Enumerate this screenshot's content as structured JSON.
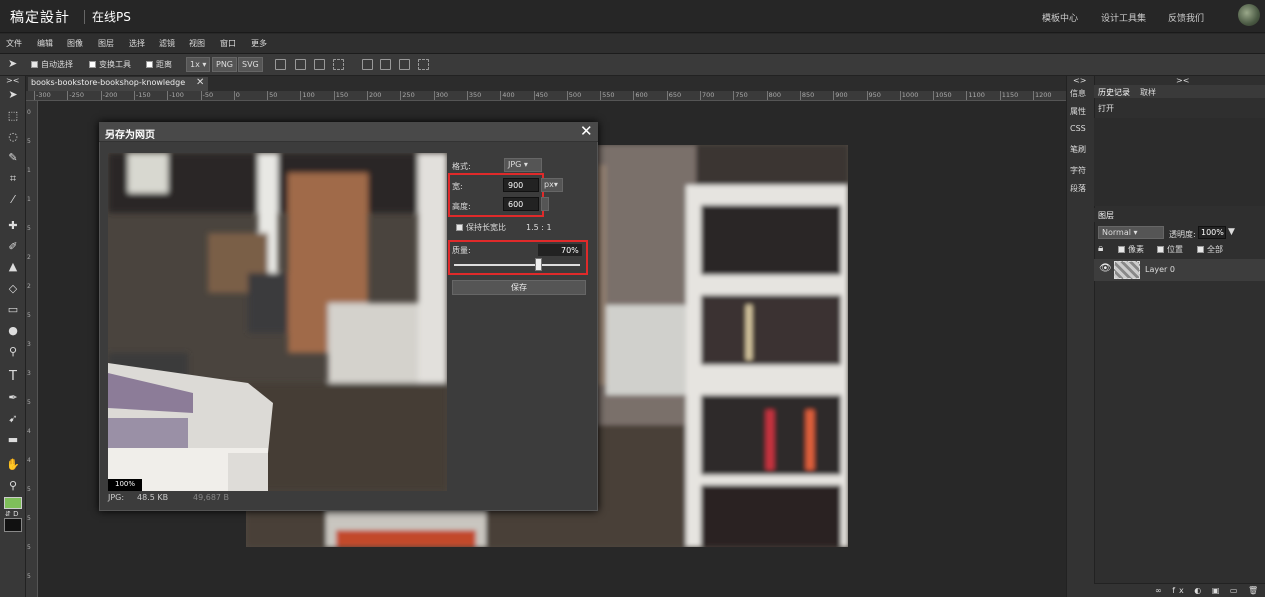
{
  "topbar": {
    "logo": "稿定設計",
    "app_name": "在线PS",
    "links": [
      "模板中心",
      "设计工具集",
      "反馈我们"
    ]
  },
  "menubar": {
    "items": [
      "文件",
      "编辑",
      "图像",
      "图层",
      "选择",
      "滤镜",
      "视图",
      "窗口",
      "更多"
    ]
  },
  "options": {
    "auto_select": "自动选择",
    "transform": "变换工具",
    "distance": "距离",
    "scale": "1x",
    "png": "PNG",
    "svg": "SVG"
  },
  "document": {
    "tab_title": "books-bookstore-bookshop-knowledge",
    "close": "✕",
    "ruler_ticks": [
      "-300",
      "-250",
      "-200",
      "-150",
      "-100",
      "-50",
      "0",
      "50",
      "100",
      "150",
      "200",
      "250",
      "300",
      "350",
      "400",
      "450",
      "500",
      "550",
      "600",
      "650",
      "700",
      "750",
      "800",
      "850",
      "900",
      "950",
      "1000",
      "1050",
      "1100",
      "1150",
      "1200"
    ],
    "ruler_v_ticks": [
      "0",
      "5",
      "1",
      "1",
      "5",
      "2",
      "2",
      "5",
      "3",
      "3",
      "5",
      "4",
      "4",
      "5",
      "5",
      "5",
      "5"
    ]
  },
  "dialog": {
    "title": "另存为网页",
    "close": "✕",
    "format_label": "格式:",
    "format_value": "JPG",
    "width_label": "宽:",
    "width_value": "900",
    "unit_value": "px",
    "height_label": "高度:",
    "height_value": "600",
    "keep_ratio_label": "保持长宽比",
    "ratio_value": "1.5 : 1",
    "quality_label": "质量:",
    "quality_value": "70%",
    "quality_level": 0.7,
    "save_label": "保存",
    "zoom": "100%",
    "file_type": "JPG:",
    "file_size": "48.5 KB",
    "file_bytes": "49,687 B"
  },
  "side_tabs": [
    "信息",
    "属性",
    "CSS",
    "笔刷",
    "字符",
    "段落"
  ],
  "right_panel": {
    "history_tab": "历史记录",
    "swatch_tab": "取样",
    "history_items": [
      "打开"
    ],
    "layers_title": "图层",
    "blend_mode": "Normal",
    "opacity_label": "透明度:",
    "opacity_value": "100%",
    "lock_label_pixels": "像素",
    "lock_label_position": "位置",
    "lock_label_all": "全部",
    "layer_name": "Layer 0"
  },
  "tools": [
    "move-icon",
    "marquee-icon",
    "lasso-icon",
    "magic-wand-icon",
    "crop-icon",
    "eyedropper-icon",
    "healing-icon",
    "brush-icon",
    "stamp-icon",
    "eraser-icon",
    "gradient-icon",
    "blur-icon",
    "dodge-icon",
    "type-icon",
    "pen-icon",
    "path-select-icon",
    "shape-icon",
    "hand-icon",
    "zoom-icon"
  ],
  "colors": {
    "foreground": "#7fbf5a",
    "background": "#111111",
    "highlight": "#e02a2a"
  }
}
